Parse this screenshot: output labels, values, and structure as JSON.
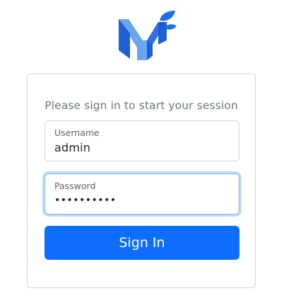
{
  "logo": {
    "name": "brand-logo"
  },
  "login": {
    "prompt": "Please sign in to start your session",
    "username": {
      "label": "Username",
      "value": "admin"
    },
    "password": {
      "label": "Password",
      "value": "••••••••••"
    },
    "submit_label": "Sign In"
  },
  "colors": {
    "primary": "#0d6efd",
    "logo_dark": "#1f5fd6",
    "logo_light": "#6aa5f0",
    "logo_leaf": "#1a72e8",
    "focus_ring": "#86b7fe"
  }
}
